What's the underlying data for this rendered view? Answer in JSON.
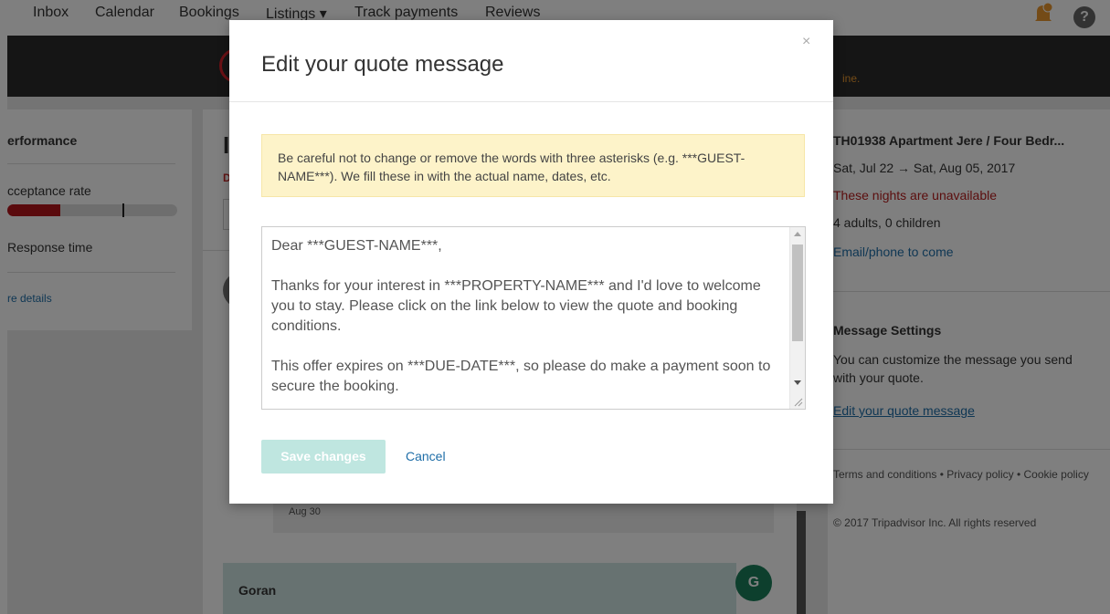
{
  "topnav": {
    "items": [
      "Inbox",
      "Calendar",
      "Bookings",
      "Listings ▾",
      "Track payments",
      "Reviews"
    ]
  },
  "notice_fragment": "ine.",
  "performance": {
    "title": "erformance",
    "acceptance_label": "cceptance rate",
    "acceptance_bar_fraction": 0.31,
    "response_label": "Response time",
    "more_link": "re details"
  },
  "center": {
    "heading": "I",
    "red_letter": "D",
    "message_date": "Aug 30",
    "sender_name": "Goran",
    "sender_initial": "G"
  },
  "booking": {
    "property": "TH01938 Apartment Jere / Four Bedr...",
    "dates": "Sat, Jul 22 → Sat, Aug 05, 2017",
    "availability": "These nights are unavailable",
    "guests": "4 adults, 0 children",
    "contact": "Email/phone to come",
    "message_settings_title": "Message Settings",
    "message_settings_desc": "You can customize the message you send with your quote.",
    "edit_link": "Edit your quote message",
    "footer_links": "Terms and conditions • Privacy policy • Cookie policy",
    "copyright": "© 2017 Tripadvisor Inc. All rights reserved"
  },
  "modal": {
    "title": "Edit your quote message",
    "close_symbol": "×",
    "warning": "Be careful not to change or remove the words with three asterisks (e.g. ***GUEST-NAME***). We fill these in with the actual name, dates, etc.",
    "message": "Dear ***GUEST-NAME***,\n\nThanks for your interest in ***PROPERTY-NAME*** and I'd love to welcome you to stay. Please click on the link below to view the quote and booking conditions.\n\nThis offer expires on ***DUE-DATE***, so please do make a payment soon to secure the booking.",
    "save_label": "Save changes",
    "cancel_label": "Cancel"
  },
  "colors": {
    "accent_teal": "#bfe6e0",
    "link_blue": "#1f6ea8",
    "warning_bg": "#fdf3c9",
    "alert_red": "#b71c1c",
    "avatar_green": "#1a7f5a"
  }
}
